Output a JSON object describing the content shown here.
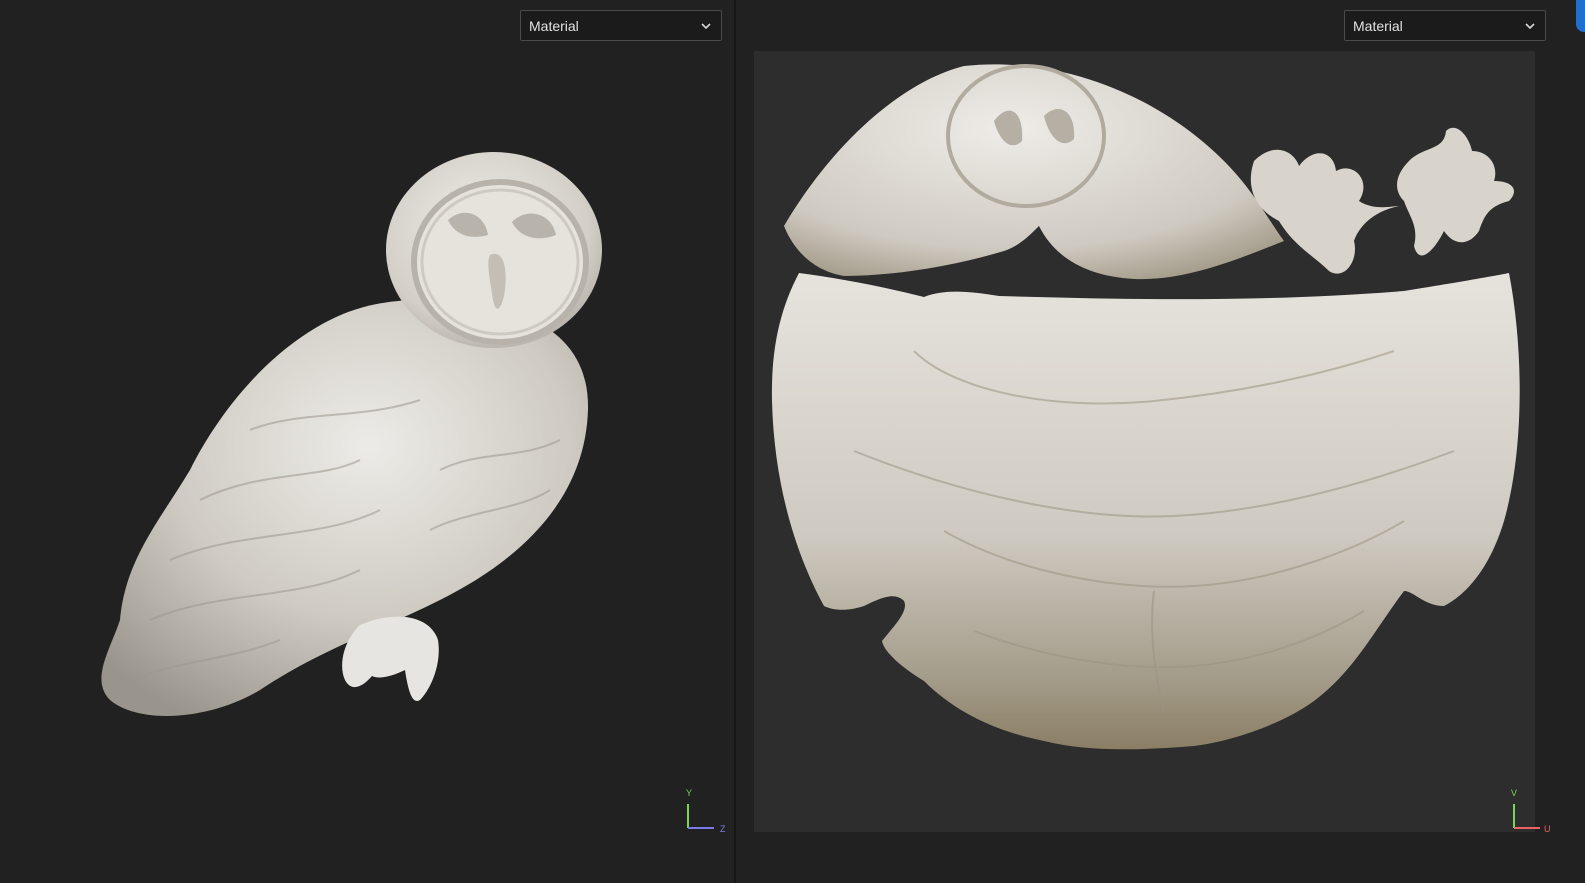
{
  "viewport_3d": {
    "render_mode": {
      "selected": "Material"
    },
    "axis": {
      "y": "Y",
      "z": "Z"
    }
  },
  "viewport_uv": {
    "render_mode": {
      "selected": "Material"
    },
    "axis": {
      "v": "V",
      "u": "U"
    }
  },
  "colors": {
    "panel_bg": "#212121",
    "uv_bg": "#2d2d2d",
    "model_surface": "#d9d6d0",
    "axis_y": "#7ad65a",
    "axis_z": "#7b7be8",
    "axis_u": "#e86464",
    "accent": "#1f6fd0"
  },
  "icons": [
    "chevron-down-icon",
    "axis-gizmo-icon"
  ]
}
